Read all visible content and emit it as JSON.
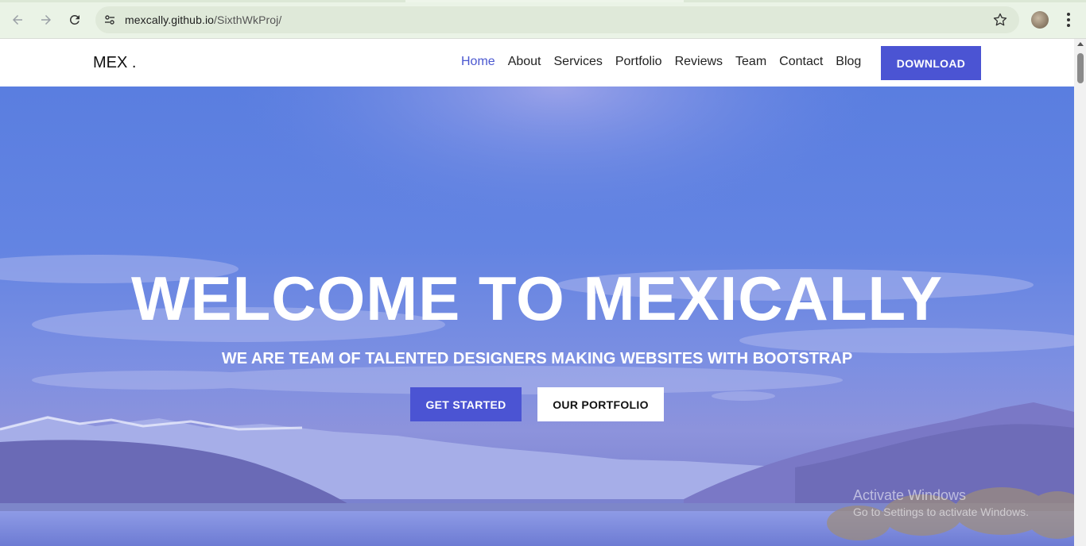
{
  "browser": {
    "url_host": "mexcally.github.io",
    "url_path": "/SixthWkProj/"
  },
  "header": {
    "logo": "MEX .",
    "nav": [
      "Home",
      "About",
      "Services",
      "Portfolio",
      "Reviews",
      "Team",
      "Contact",
      "Blog"
    ],
    "active_nav": "Home",
    "download_label": "DOWNLOAD"
  },
  "hero": {
    "title": "WELCOME TO MEXICALLY",
    "subtitle": "WE ARE TEAM OF TALENTED DESIGNERS MAKING WEBSITES WITH BOOTSTRAP",
    "get_started_label": "GET STARTED",
    "portfolio_label": "OUR PORTFOLIO"
  },
  "watermark": {
    "title": "Activate Windows",
    "subtitle": "Go to Settings to activate Windows."
  },
  "colors": {
    "accent": "#4b54d3",
    "hero_overlay": "#5a7ee0"
  }
}
